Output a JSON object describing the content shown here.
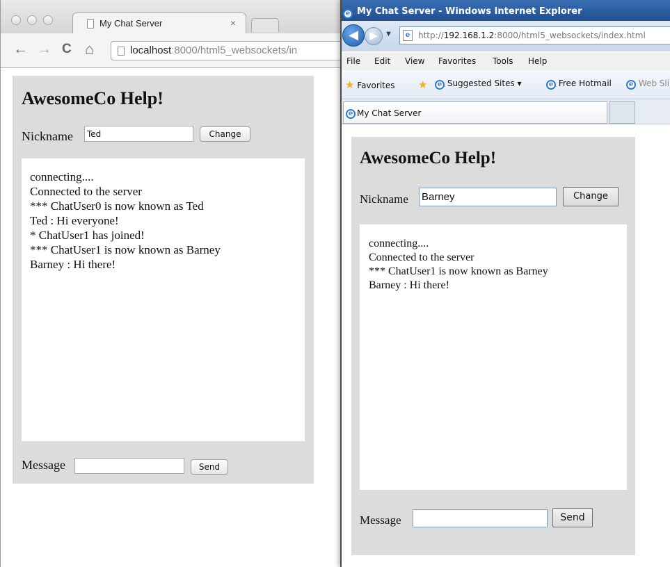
{
  "chrome": {
    "tab_title": "My Chat Server",
    "tab_close": "×",
    "nav": {
      "back": "←",
      "forward": "→",
      "reload": "C",
      "home": "⌂"
    },
    "url_host": "localhost",
    "url_rest": ":8000/html5_websockets/in"
  },
  "chrome_page": {
    "heading": "AwesomeCo Help!",
    "nickname_label": "Nickname",
    "nickname_value": "Ted",
    "change_label": "Change",
    "chat_lines": [
      "connecting....",
      "Connected to the server",
      "*** ChatUser0 is now known as Ted",
      "Ted : Hi everyone!",
      "* ChatUser1 has joined!",
      "*** ChatUser1 is now known as Barney",
      "Barney : Hi there!"
    ],
    "message_label": "Message",
    "message_value": "",
    "send_label": "Send"
  },
  "ie": {
    "window_title": "My Chat Server - Windows Internet Explorer",
    "url_prefix": "http://",
    "url_host": "192.168.1.2",
    "url_rest": ":8000/html5_websockets/index.html",
    "menu": [
      "File",
      "Edit",
      "View",
      "Favorites",
      "Tools",
      "Help"
    ],
    "favorites_label": "Favorites",
    "suggested_sites": "Suggested Sites ▾",
    "free_hotmail": "Free Hotmail",
    "web_slice": "Web Sli",
    "tab_title": "My Chat Server"
  },
  "ie_page": {
    "heading": "AwesomeCo Help!",
    "nickname_label": "Nickname",
    "nickname_value": "Barney",
    "change_label": "Change",
    "chat_lines": [
      "connecting....",
      "Connected to the server",
      "*** ChatUser1 is now known as Barney",
      "Barney : Hi there!"
    ],
    "message_label": "Message",
    "message_value": "",
    "send_label": "Send"
  }
}
